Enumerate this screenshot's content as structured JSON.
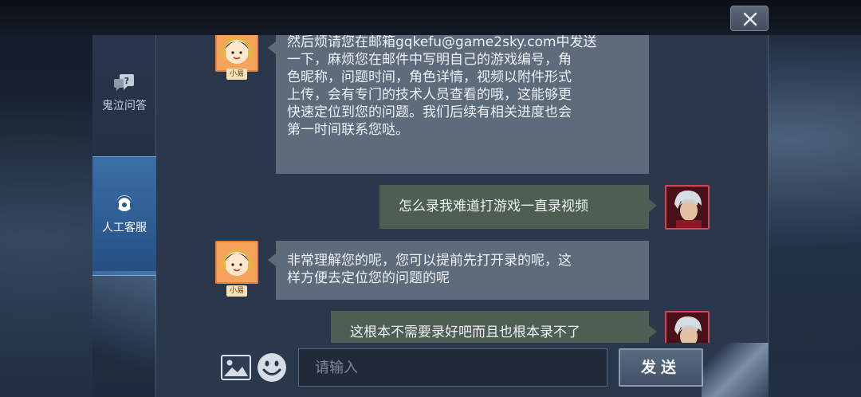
{
  "window": {
    "close_label": "✕"
  },
  "sidebar": {
    "items": [
      {
        "label": "鬼泣问答",
        "icon": "question-bubble-icon",
        "active": false
      },
      {
        "label": "人工客服",
        "icon": "headset-icon",
        "active": true
      }
    ]
  },
  "messages": [
    {
      "sender": "service",
      "avatar_tag": "小易",
      "lines": [
        "然后烦请您在邮箱gqkefu@game2sky.com中发送",
        "一下，麻烦您在邮件中写明自己的游戏编号，角",
        "色昵称，问题时间，角色详情，视频以附件形式",
        "上传，会有专门的技术人员查看的哦，这能够更",
        "快速定位到您的问题。我们后续有相关进度也会",
        "第一时间联系您哒。"
      ]
    },
    {
      "sender": "user",
      "lines": [
        "怎么录我难道打游戏一直录视频"
      ]
    },
    {
      "sender": "service",
      "avatar_tag": "小易",
      "lines": [
        "非常理解您的呢，您可以提前先打开录的呢，这",
        "样方便去定位您的问题的呢"
      ]
    },
    {
      "sender": "user",
      "lines": [
        "这根本不需要录好吧而且也根本录不了"
      ]
    }
  ],
  "composer": {
    "image_icon": "image-icon",
    "emoji_icon": "emoji-icon",
    "placeholder": "请输入",
    "value": "",
    "send_label": "发送"
  },
  "colors": {
    "service_bubble": "#5d6b7a",
    "user_bubble": "#4e5e52",
    "active_tab": "#2c5c92"
  }
}
